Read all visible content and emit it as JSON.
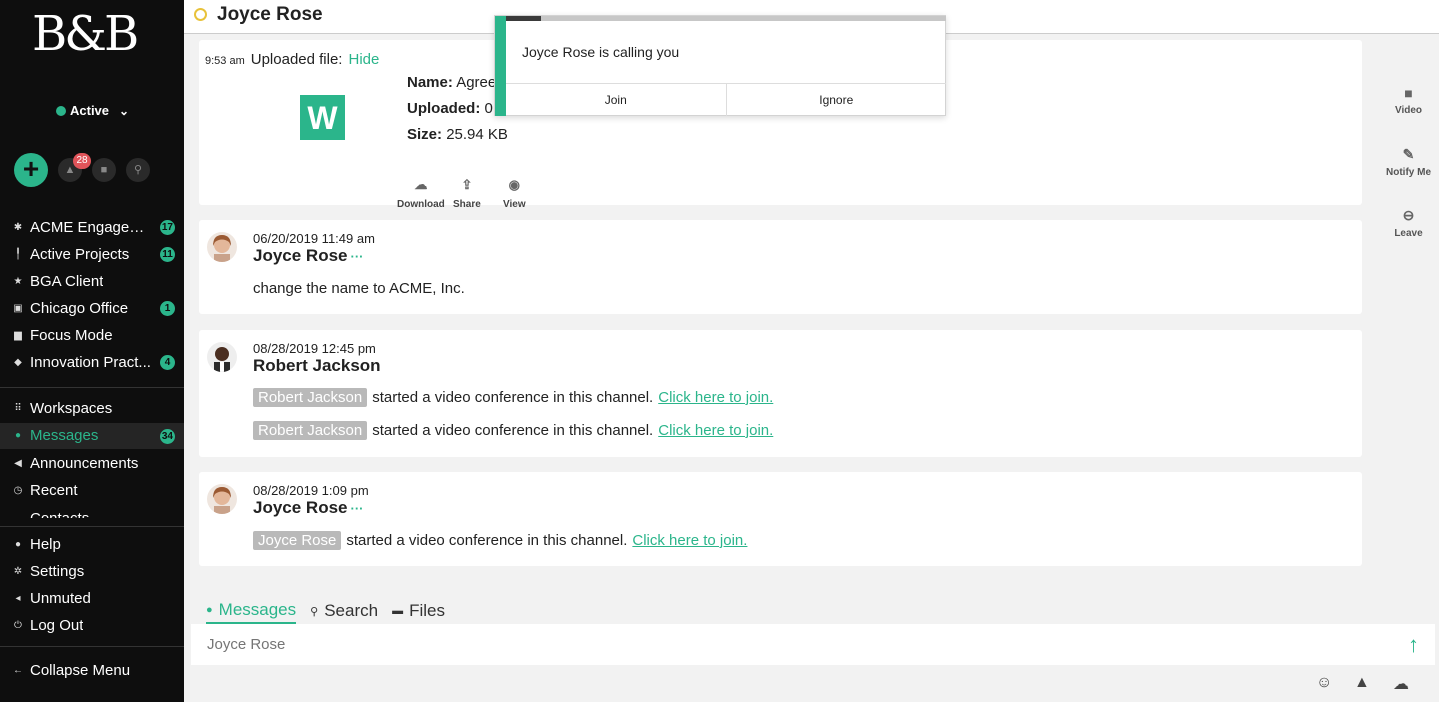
{
  "app": {
    "logo": "B&B"
  },
  "sidebar": {
    "status_label": "Active",
    "alerts_count": "28",
    "channels": [
      {
        "label": "ACME Engagem...",
        "count": "17",
        "icon": "gear-icon",
        "glyph": "✱"
      },
      {
        "label": "Active Projects",
        "count": "11",
        "icon": "pin-icon",
        "glyph": "╿"
      },
      {
        "label": "BGA Client",
        "count": "",
        "icon": "star-icon",
        "glyph": "★"
      },
      {
        "label": "Chicago Office",
        "count": "1",
        "icon": "building-icon",
        "glyph": "▣"
      },
      {
        "label": "Focus Mode",
        "count": "",
        "icon": "briefcase-icon",
        "glyph": "▆"
      },
      {
        "label": "Innovation Pract...",
        "count": "4",
        "icon": "graduation-cap-icon",
        "glyph": "◆"
      }
    ],
    "nav": [
      {
        "label": "Workspaces",
        "count": "",
        "icon": "grid-icon",
        "glyph": "⠿"
      },
      {
        "label": "Messages",
        "count": "34",
        "icon": "chat-icon",
        "glyph": "●"
      },
      {
        "label": "Announcements",
        "count": "",
        "icon": "megaphone-icon",
        "glyph": "◀"
      },
      {
        "label": "Recent",
        "count": "",
        "icon": "history-icon",
        "glyph": "◷"
      },
      {
        "label": "Contacts",
        "count": "",
        "icon": "contacts-icon",
        "glyph": "▬"
      }
    ],
    "footer": [
      {
        "label": "Help",
        "icon": "help-icon",
        "glyph": "●"
      },
      {
        "label": "Settings",
        "icon": "gear-icon",
        "glyph": "✲"
      },
      {
        "label": "Unmuted",
        "icon": "speaker-icon",
        "glyph": "◂"
      },
      {
        "label": "Log Out",
        "icon": "power-icon",
        "glyph": "⏻"
      }
    ],
    "collapse_label": "Collapse Menu"
  },
  "header": {
    "title": "Joyce Rose"
  },
  "rail": {
    "video": "Video",
    "notify": "Notify Me",
    "leave": "Leave"
  },
  "file_message": {
    "time": "9:53 am",
    "text": "Uploaded file:",
    "hide_label": "Hide",
    "name_label": "Name:",
    "name_value": "Agree",
    "uploaded_label": "Uploaded:",
    "uploaded_value": "0",
    "size_label": "Size:",
    "size_value": "25.94 KB",
    "file_icon_letter": "W",
    "actions": {
      "download": "Download",
      "share": "Share",
      "view": "View"
    }
  },
  "messages": [
    {
      "date": "06/20/2019 11:49 am",
      "author": "Joyce Rose",
      "dots": "···",
      "text": "change the name to ACME, Inc."
    },
    {
      "date": "08/28/2019 12:45 pm",
      "author": "Robert Jackson",
      "lines": [
        {
          "chip": "Robert Jackson",
          "text": "started a video conference in this channel.",
          "link": "Click here to join."
        },
        {
          "chip": "Robert Jackson",
          "text": "started a video conference in this channel.",
          "link": "Click here to join."
        }
      ]
    },
    {
      "date": "08/28/2019 1:09 pm",
      "author": "Joyce Rose",
      "dots": "···",
      "lines": [
        {
          "chip": "Joyce Rose",
          "text": "started a video conference in this channel.",
          "link": "Click here to join."
        }
      ]
    }
  ],
  "tabs": {
    "messages": "Messages",
    "search": "Search",
    "files": "Files"
  },
  "composer": {
    "placeholder": "Joyce Rose"
  },
  "call_popup": {
    "message": "Joyce Rose is calling you",
    "join": "Join",
    "ignore": "Ignore",
    "progress": 0.08
  },
  "colors": {
    "accent": "#2bb58b",
    "sidebar_bg": "#0e0e0e",
    "badge_red": "#e0545a"
  }
}
